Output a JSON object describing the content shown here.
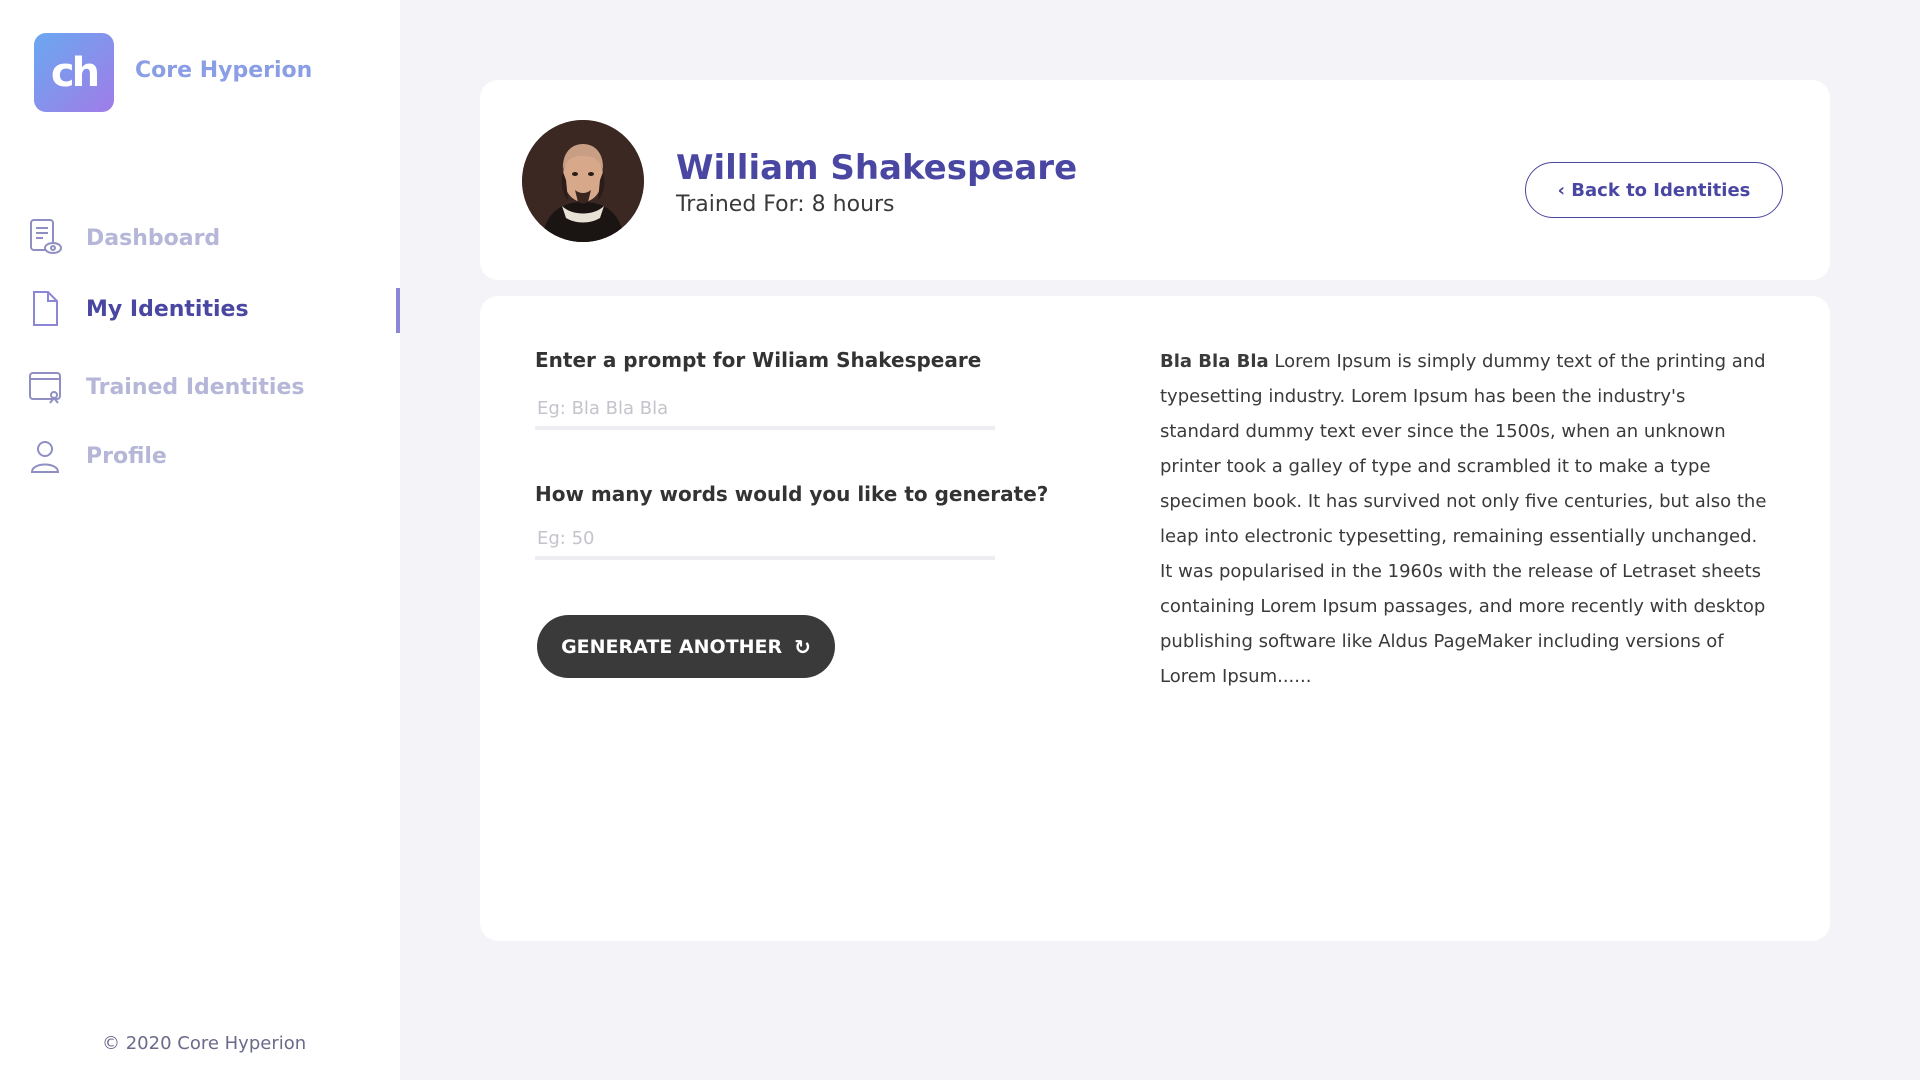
{
  "brand": {
    "logo_text": "ch",
    "name": "Core Hyperion"
  },
  "nav": [
    {
      "label": "Dashboard",
      "icon": "dashboard-icon",
      "active": false
    },
    {
      "label": "My Identities",
      "icon": "document-icon",
      "active": true
    },
    {
      "label": "Trained Identities",
      "icon": "trained-icon",
      "active": false
    },
    {
      "label": "Profile",
      "icon": "user-icon",
      "active": false
    }
  ],
  "footer": {
    "copyright": "© 2020 Core Hyperion"
  },
  "identity": {
    "name": "William Shakespeare",
    "trained_for": "Trained For: 8 hours",
    "back_label": "‹ Back to Identities"
  },
  "form": {
    "prompt_label": "Enter a prompt for Wiliam Shakespeare",
    "prompt_placeholder": "Eg: Bla Bla Bla",
    "words_label": "How many words would you like to generate?",
    "words_placeholder": "Eg: 50",
    "generate_label": "GENERATE ANOTHER"
  },
  "output": {
    "lead": "Bla Bla Bla",
    "body": "Lorem Ipsum is simply dummy text of the printing and typesetting industry. Lorem Ipsum has been the industry's standard dummy text ever since the 1500s, when an unknown printer took a galley of type and scrambled it to make a type specimen book. It has survived not only five centuries, but also the leap into electronic typesetting, remaining essentially unchanged. It was popularised in the 1960s with the release of Letraset sheets containing Lorem Ipsum passages, and more recently with desktop publishing software like Aldus PageMaker including versions of Lorem Ipsum......"
  },
  "colors": {
    "accent": "#4a47a3",
    "nav_inactive": "#b6b6d8",
    "background": "#f3f3f8",
    "button_dark": "#3a3a3a"
  }
}
